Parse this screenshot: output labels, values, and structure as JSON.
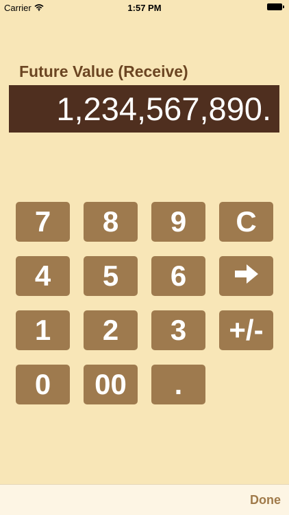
{
  "status_bar": {
    "carrier": "Carrier",
    "time": "1:57 PM"
  },
  "field": {
    "label": "Future Value (Receive)",
    "display_value": "1,234,567,890."
  },
  "keypad": {
    "keys": {
      "k7": "7",
      "k8": "8",
      "k9": "9",
      "clear": "C",
      "k4": "4",
      "k5": "5",
      "k6": "6",
      "k1": "1",
      "k2": "2",
      "k3": "3",
      "sign": "+/-",
      "k0": "0",
      "k00": "00",
      "decimal": "."
    },
    "next_icon": "arrow-right-icon"
  },
  "toolbar": {
    "done_label": "Done"
  }
}
